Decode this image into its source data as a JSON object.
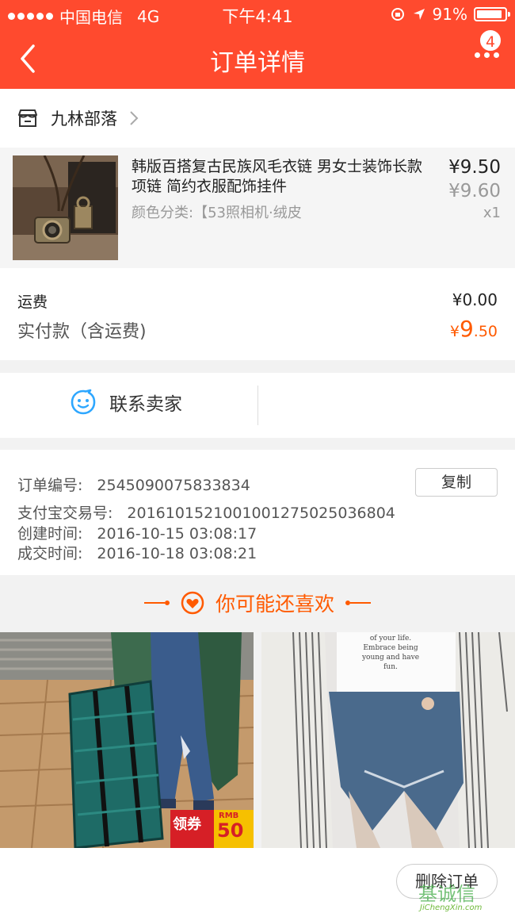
{
  "status_bar": {
    "carrier": "中国电信",
    "network": "4G",
    "time": "下午4:41",
    "battery": "91%",
    "battery_level": 0.91
  },
  "nav": {
    "title": "订单详情",
    "badge": "4"
  },
  "shop": {
    "name": "九林部落"
  },
  "product": {
    "title": "韩版百搭复古民族风毛衣链 男女士装饰长款项链 简约衣服配饰挂件",
    "sku": "颜色分类:【53照相机·绒皮",
    "price": "¥9.50",
    "original_price": "¥9.60",
    "quantity": "x1"
  },
  "fees": {
    "shipping_label": "运费",
    "shipping_value": "¥0.00",
    "total_label": "实付款（含运费)",
    "total_currency": "¥",
    "total_int": "9",
    "total_dec": ".50"
  },
  "contact": {
    "label": "联系卖家"
  },
  "order": {
    "number_label": "订单编号:",
    "number_value": "2545090075833834",
    "copy_label": "复制",
    "alipay_label": "支付宝交易号:",
    "alipay_value": "2016101521001001275025036804",
    "created_label": "创建时间:",
    "created_value": "2016-10-15 03:08:17",
    "closed_label": "成交时间:",
    "closed_value": "2016-10-18 03:08:21"
  },
  "recommend": {
    "title": "你可能还喜欢",
    "item1_tag": "领券",
    "item1_rmb": "RMB",
    "item1_num": "50",
    "item2_shirt_text": "of your life. Embrace being young and have fun."
  },
  "bottom": {
    "delete_label": "删除订单",
    "watermark_cn": "基诚信",
    "watermark_en": "JiChengXin.com"
  },
  "colors": {
    "brand": "#ff4a2e",
    "price_accent": "#ff5a00",
    "contact_icon": "#2ea7ff"
  }
}
